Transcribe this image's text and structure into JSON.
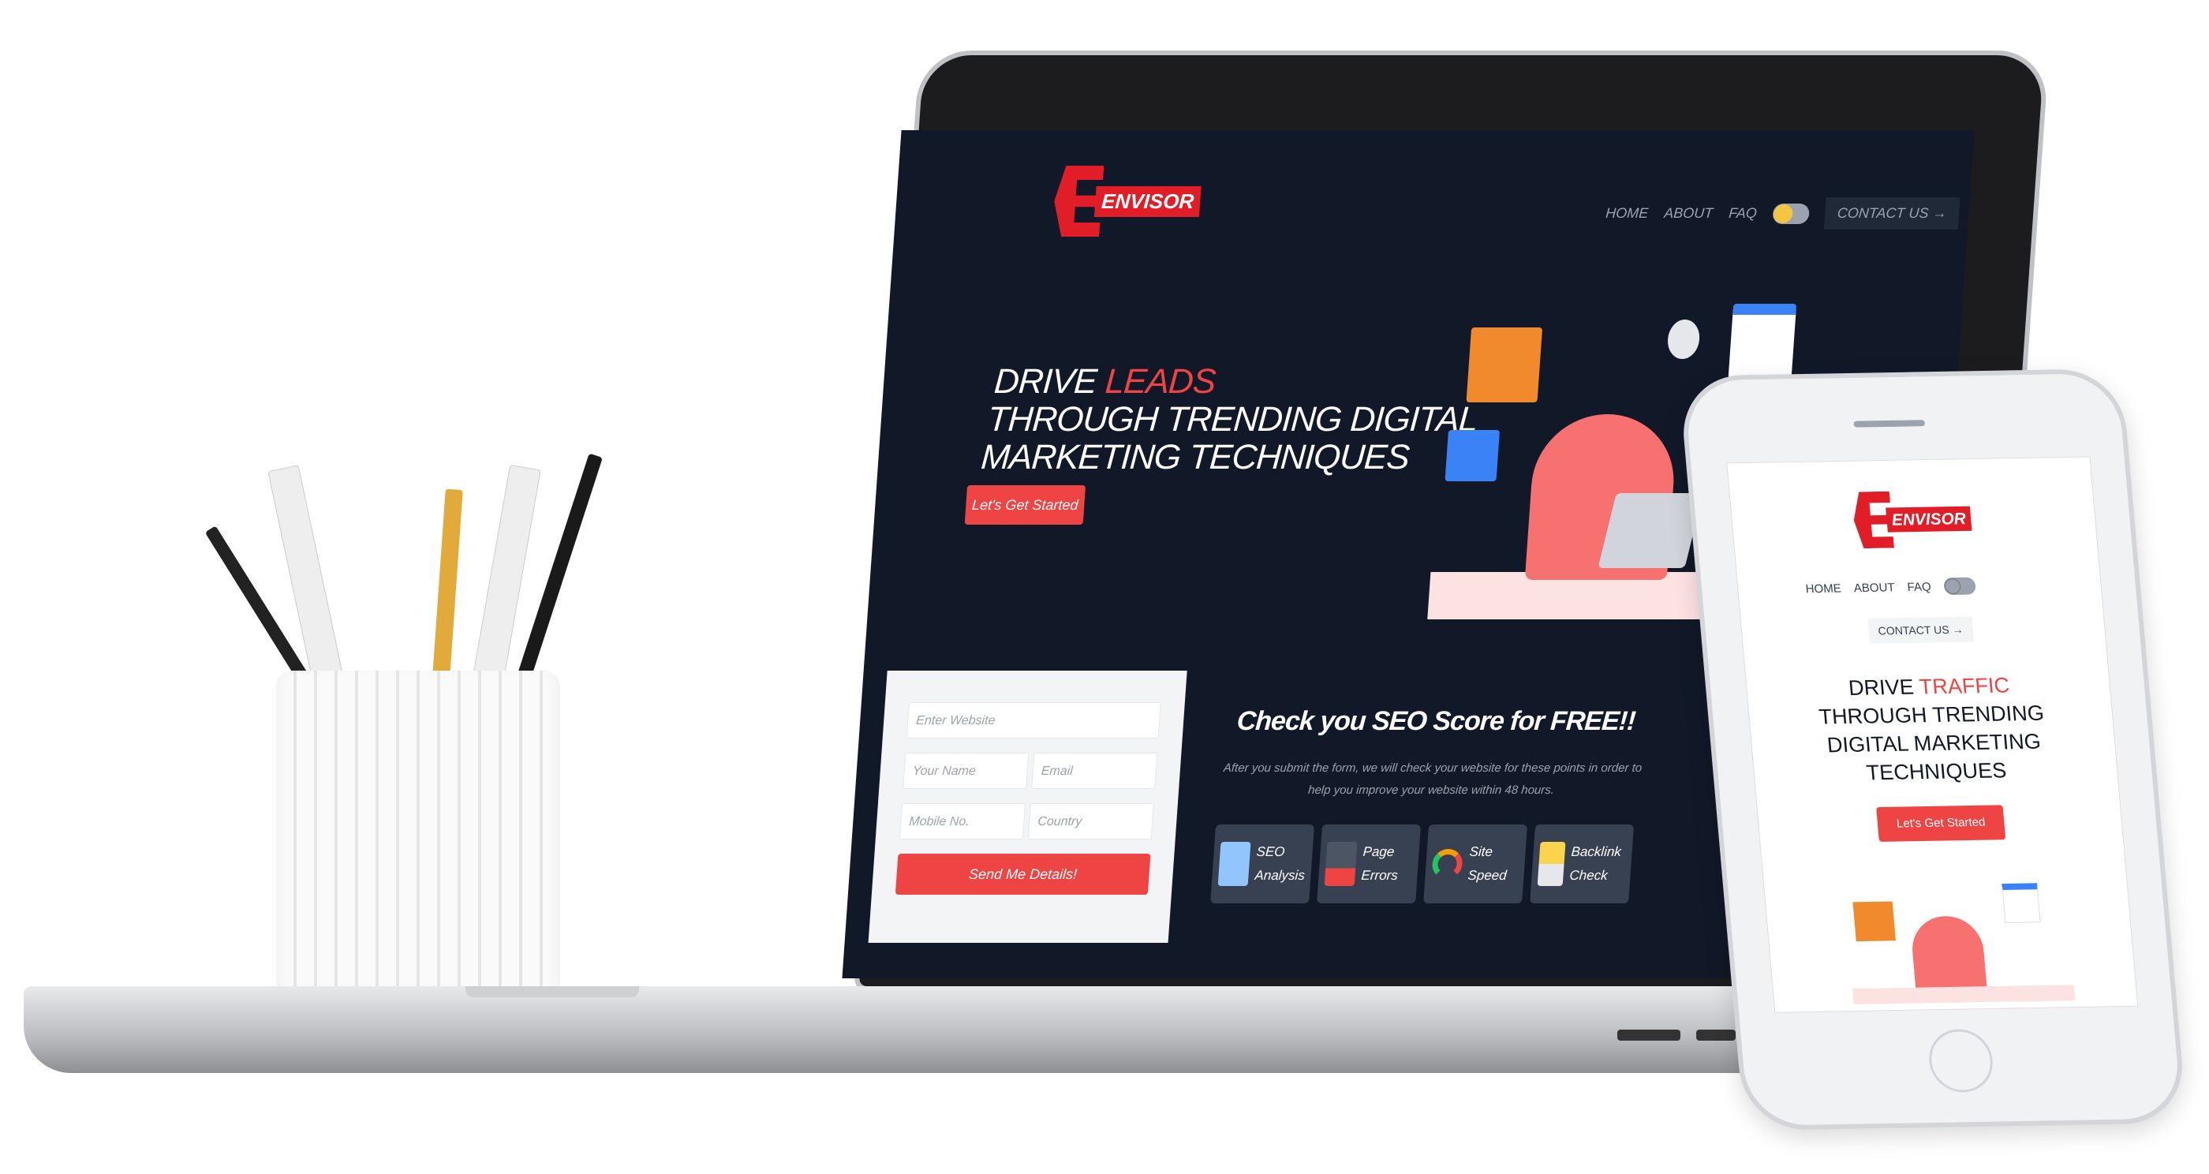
{
  "laptop_site": {
    "logo_text": "ENVISOR",
    "nav": [
      "HOME",
      "ABOUT",
      "FAQ"
    ],
    "contact_label": "CONTACT US →",
    "hero": {
      "line1_prefix": "DRIVE ",
      "line1_highlight": "LEADS",
      "line2": "THROUGH TRENDING DIGITAL",
      "line3": "MARKETING TECHNIQUES"
    },
    "cta_label": "Let's Get Started",
    "form": {
      "website_placeholder": "Enter Website",
      "name_placeholder": "Your Name",
      "email_placeholder": "Email",
      "mobile_placeholder": "Mobile No.",
      "country_placeholder": "Country",
      "submit_label": "Send Me Details!"
    },
    "seo": {
      "title": "Check you SEO Score for FREE!!",
      "description": "After you submit the form, we will check your website for these points in order to help you improve your website within 48 hours.",
      "features": [
        {
          "line1": "SEO",
          "line2": "Analysis",
          "icon": "seo-analysis-icon"
        },
        {
          "line1": "Page",
          "line2": "Errors",
          "icon": "page-errors-icon"
        },
        {
          "line1": "Site",
          "line2": "Speed",
          "icon": "speedometer-icon"
        },
        {
          "line1": "Backlink",
          "line2": "Check",
          "icon": "backlink-icon"
        }
      ]
    }
  },
  "phone_site": {
    "logo_text": "ENVISOR",
    "nav": [
      "HOME",
      "ABOUT",
      "FAQ"
    ],
    "contact_label": "CONTACT US →",
    "hero": {
      "line1_prefix": "DRIVE ",
      "line1_highlight": "TRAFFIC",
      "line2": "THROUGH TRENDING",
      "line3": "DIGITAL MARKETING",
      "line4": "TECHNIQUES"
    },
    "cta_label": "Let's Get Started"
  },
  "colors": {
    "accent": "#ef4444",
    "dark_bg": "#111827",
    "logo_red": "#e11d27"
  }
}
